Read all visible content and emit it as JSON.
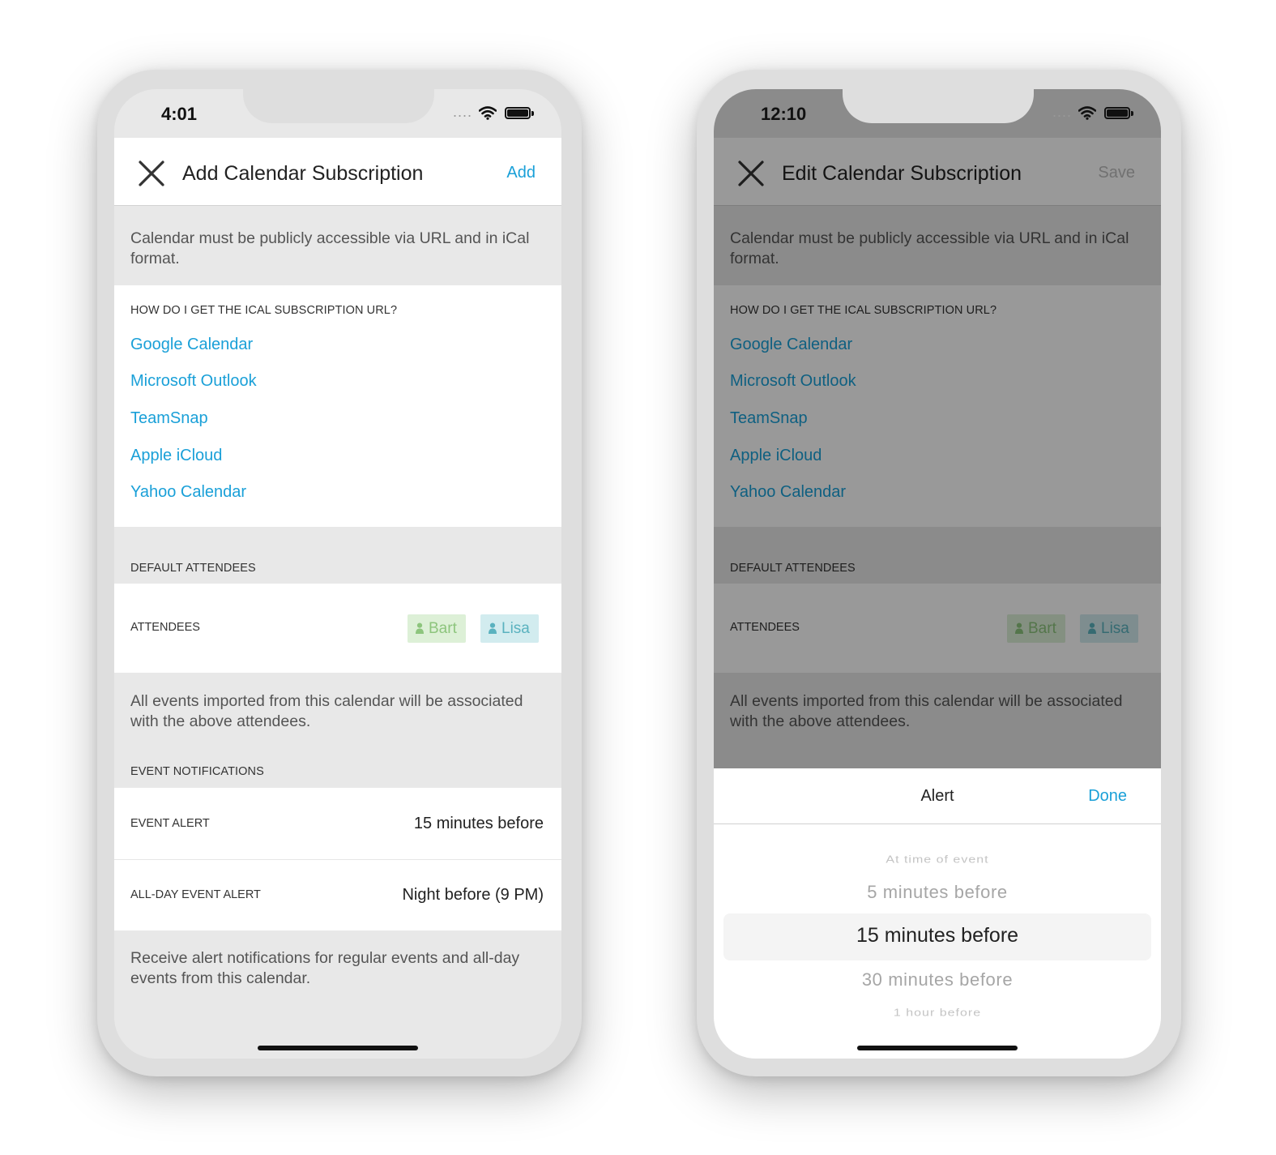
{
  "colors": {
    "accent": "#1aa0d8",
    "bart_chip_bg": "#ddf0d7",
    "bart_chip_text": "#8dc57d",
    "lisa_chip_bg": "#d2ecef",
    "lisa_chip_text": "#5ab2bf",
    "disabled": "#bdbdbd"
  },
  "icons": {
    "close": "close-icon",
    "wifi": "wifi-icon",
    "battery": "battery-icon",
    "person": "person-icon"
  },
  "phones": [
    {
      "status_time": "4:01",
      "status_dots": "....",
      "header": {
        "title": "Add Calendar Subscription",
        "action": "Add"
      },
      "info": "Calendar must be publicly accessible via URL and in iCal format.",
      "how_heading": "HOW DO I GET THE ICAL SUBSCRIPTION URL?",
      "links": [
        "Google Calendar",
        "Microsoft Outlook",
        "TeamSnap",
        "Apple iCloud",
        "Yahoo Calendar"
      ],
      "default_attendees_heading": "DEFAULT ATTENDEES",
      "attendees_label": "ATTENDEES",
      "attendees": [
        "Bart",
        "Lisa"
      ],
      "attendees_note": "All events imported from this calendar will be associated with the above attendees.",
      "notifications_heading": "EVENT NOTIFICATIONS",
      "event_alert_label": "EVENT ALERT",
      "event_alert_value": "15 minutes before",
      "allday_alert_label": "ALL-DAY EVENT ALERT",
      "allday_alert_value": "Night before (9 PM)",
      "alert_note": "Receive alert notifications for regular events and all-day events from this calendar."
    },
    {
      "status_time": "12:10",
      "status_dots": "....",
      "header": {
        "title": "Edit Calendar Subscription",
        "action": "Save"
      },
      "info": "Calendar must be publicly accessible via URL and in iCal format.",
      "how_heading": "HOW DO I GET THE ICAL SUBSCRIPTION URL?",
      "links": [
        "Google Calendar",
        "Microsoft Outlook",
        "TeamSnap",
        "Apple iCloud",
        "Yahoo Calendar"
      ],
      "default_attendees_heading": "DEFAULT ATTENDEES",
      "attendees_label": "ATTENDEES",
      "attendees": [
        "Bart",
        "Lisa"
      ],
      "attendees_note": "All events imported from this calendar will be associated with the above attendees.",
      "sheet": {
        "title": "Alert",
        "done": "Done",
        "options": [
          "At time of event",
          "5 minutes before",
          "15 minutes before",
          "30 minutes before",
          "1 hour before"
        ],
        "selected": "15 minutes before"
      }
    }
  ]
}
